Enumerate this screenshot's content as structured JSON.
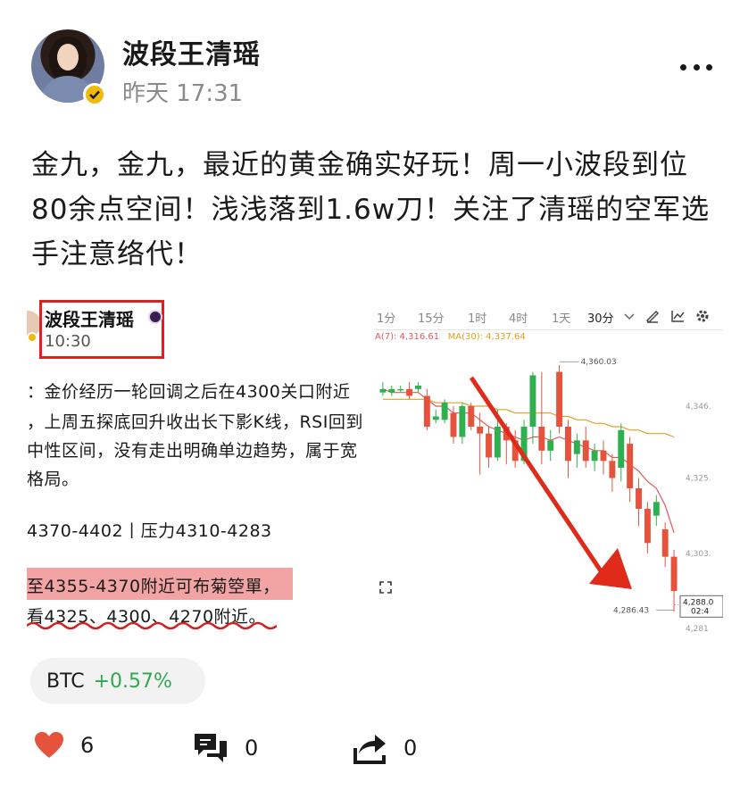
{
  "post": {
    "author": "波段王清瑶",
    "time": "昨天 17:31",
    "text": "金九，金九，最近的黄金确实好玩！周一小波段到位80余点空间！浅浅落到1.6w刀！关注了清瑶的空军选手注意络代！"
  },
  "embedded_left": {
    "author": "波段王清瑶",
    "time": "10:30",
    "lines": [
      "：金价经历一轮回调之后在4300关口附近",
      "，上周五探底回升收出长下影K线，RSI回到",
      "中性区间，没有走出明确单边趋势，属于宽",
      "格局。",
      "4370-4402丨压力4310-4283",
      "至4355-4370附近可布菊箜單，",
      "看4325、4300、4270附近。"
    ]
  },
  "embedded_chart": {
    "tabs": [
      "1分",
      "15分",
      "1时",
      "4时",
      "1天",
      "30分"
    ],
    "active_tab_index": 5,
    "ma_a_label": "A(7): 4,316.61",
    "ma_b_label": "MA(30): 4,337.64",
    "high_label": "4,360.03",
    "low_label": "4,286.43",
    "price_tag": "4,288.0",
    "price_tag_time": "02:4",
    "colors": {
      "up": "#2fb04f",
      "down": "#e5533d",
      "ma_fast": "#e05a5a",
      "ma_slow": "#e0a020",
      "arrow": "#e02a1a"
    }
  },
  "chart_data": {
    "type": "candlestick",
    "title": "",
    "xlabel": "",
    "ylabel": "",
    "y_ticks": [
      "4,346.",
      "4,325.",
      "4,303.",
      "4,281"
    ],
    "ylim": [
      4280,
      4364
    ],
    "candles": [
      {
        "o": 4350,
        "c": 4351,
        "h": 4353,
        "l": 4349
      },
      {
        "o": 4350,
        "c": 4351,
        "h": 4352,
        "l": 4349
      },
      {
        "o": 4351,
        "c": 4351,
        "h": 4352,
        "l": 4350
      },
      {
        "o": 4351,
        "c": 4349,
        "h": 4353,
        "l": 4348
      },
      {
        "o": 4351,
        "c": 4352,
        "h": 4353,
        "l": 4350
      },
      {
        "o": 4349,
        "c": 4340,
        "h": 4351,
        "l": 4339
      },
      {
        "o": 4342,
        "c": 4343,
        "h": 4345,
        "l": 4341
      },
      {
        "o": 4342,
        "c": 4347,
        "h": 4348,
        "l": 4341
      },
      {
        "o": 4344,
        "c": 4337,
        "h": 4346,
        "l": 4335
      },
      {
        "o": 4337,
        "c": 4346,
        "h": 4347,
        "l": 4335
      },
      {
        "o": 4346,
        "c": 4340,
        "h": 4347,
        "l": 4339
      },
      {
        "o": 4340,
        "c": 4338,
        "h": 4344,
        "l": 4326
      },
      {
        "o": 4338,
        "c": 4331,
        "h": 4340,
        "l": 4328
      },
      {
        "o": 4331,
        "c": 4340,
        "h": 4345,
        "l": 4330
      },
      {
        "o": 4340,
        "c": 4336,
        "h": 4341,
        "l": 4329
      },
      {
        "o": 4336,
        "c": 4330,
        "h": 4339,
        "l": 4328
      },
      {
        "o": 4330,
        "c": 4340,
        "h": 4342,
        "l": 4329
      },
      {
        "o": 4340,
        "c": 4355,
        "h": 4356,
        "l": 4335
      },
      {
        "o": 4340,
        "c": 4333,
        "h": 4356,
        "l": 4329
      },
      {
        "o": 4333,
        "c": 4336,
        "h": 4339,
        "l": 4330
      },
      {
        "o": 4356,
        "c": 4340,
        "h": 4358,
        "l": 4338
      },
      {
        "o": 4340,
        "c": 4330,
        "h": 4342,
        "l": 4325
      },
      {
        "o": 4332,
        "c": 4336,
        "h": 4338,
        "l": 4328
      },
      {
        "o": 4336,
        "c": 4330,
        "h": 4340,
        "l": 4328
      },
      {
        "o": 4330,
        "c": 4333,
        "h": 4335,
        "l": 4327
      },
      {
        "o": 4333,
        "c": 4330,
        "h": 4336,
        "l": 4326
      },
      {
        "o": 4330,
        "c": 4325,
        "h": 4332,
        "l": 4321
      },
      {
        "o": 4328,
        "c": 4339,
        "h": 4341,
        "l": 4324
      },
      {
        "o": 4335,
        "c": 4322,
        "h": 4337,
        "l": 4318
      },
      {
        "o": 4322,
        "c": 4316,
        "h": 4325,
        "l": 4311
      },
      {
        "o": 4316,
        "c": 4306,
        "h": 4318,
        "l": 4303
      },
      {
        "o": 4314,
        "c": 4318,
        "h": 4320,
        "l": 4311
      },
      {
        "o": 4310,
        "c": 4302,
        "h": 4312,
        "l": 4299
      },
      {
        "o": 4302,
        "c": 4292,
        "h": 4304,
        "l": 4286
      }
    ],
    "ma_fast": [
      4351,
      4350,
      4350,
      4350,
      4350,
      4348,
      4346,
      4346,
      4344,
      4344,
      4344,
      4342,
      4340,
      4339,
      4338,
      4337,
      4336,
      4337,
      4337,
      4336,
      4337,
      4336,
      4335,
      4334,
      4333,
      4333,
      4331,
      4331,
      4329,
      4327,
      4324,
      4322,
      4317,
      4309
    ],
    "ma_slow": [
      4348,
      4348,
      4348,
      4348,
      4348,
      4348,
      4347,
      4347,
      4347,
      4347,
      4346,
      4346,
      4346,
      4345,
      4345,
      4344,
      4344,
      4344,
      4344,
      4344,
      4343,
      4343,
      4342,
      4342,
      4341,
      4341,
      4340,
      4340,
      4339,
      4339,
      4338,
      4338,
      4338,
      4337
    ]
  },
  "ticker": {
    "symbol": "BTC",
    "change": "+0.57%"
  },
  "actions": {
    "likes": "6",
    "comments": "0",
    "shares": "0"
  }
}
